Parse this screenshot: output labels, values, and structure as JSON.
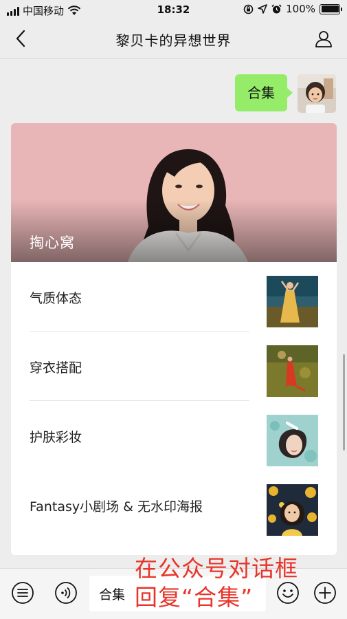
{
  "status_bar": {
    "carrier": "中国移动",
    "time": "18:32",
    "battery": "100%"
  },
  "nav": {
    "title": "黎贝卡的异想世界",
    "back_icon": "chevron-left-icon",
    "profile_icon": "person-icon"
  },
  "message": {
    "text": "合集"
  },
  "card": {
    "cover_title": "掏心窝",
    "articles": [
      {
        "title": "气质体态"
      },
      {
        "title": "穿衣搭配"
      },
      {
        "title": "护肤彩妆"
      },
      {
        "title": "Fantasy小剧场 & 无水印海报"
      }
    ]
  },
  "input_bar": {
    "value": "合集",
    "menu_icon": "menu-list-icon",
    "voice_icon": "voice-icon",
    "emoji_icon": "emoji-icon",
    "plus_icon": "plus-icon"
  },
  "overlay": {
    "line1": "在公众号对话框",
    "line2": "回复“合集”"
  },
  "colors": {
    "bubble": "#95ec69",
    "overlay_text": "#e8352b",
    "background": "#ededed"
  }
}
